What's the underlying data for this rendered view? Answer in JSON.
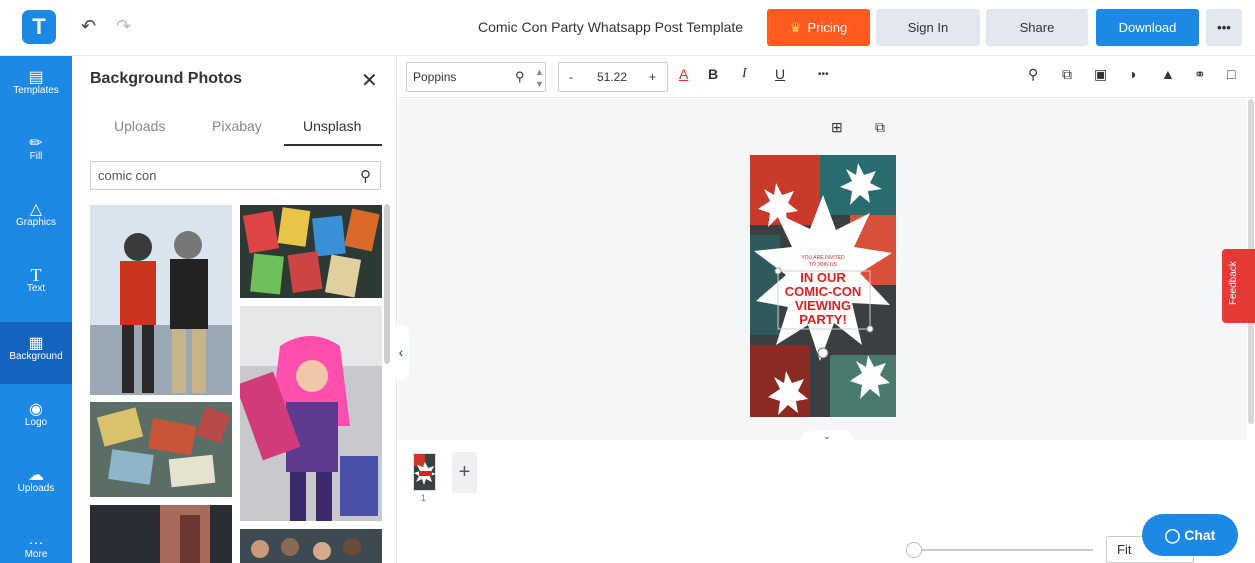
{
  "header": {
    "logo_letter": "T",
    "doc_title": "Comic Con Party Whatsapp Post Template",
    "pricing_label": "Pricing",
    "signin_label": "Sign In",
    "share_label": "Share",
    "download_label": "Download",
    "more_label": "•••"
  },
  "rail": {
    "items": [
      {
        "label": "Templates",
        "icon": "templates-icon"
      },
      {
        "label": "Fill",
        "icon": "pencil-icon"
      },
      {
        "label": "Graphics",
        "icon": "shapes-icon"
      },
      {
        "label": "Text",
        "icon": "text-icon"
      },
      {
        "label": "Background",
        "icon": "background-icon"
      },
      {
        "label": "Logo",
        "icon": "logo-icon"
      },
      {
        "label": "Uploads",
        "icon": "cloud-upload-icon"
      },
      {
        "label": "More",
        "icon": "more-icon"
      }
    ],
    "active": "Background"
  },
  "panel": {
    "title": "Background Photos",
    "tabs": [
      "Uploads",
      "Pixabay",
      "Unsplash"
    ],
    "active_tab": "Unsplash",
    "search_value": "comic con"
  },
  "toolbar": {
    "font": "Poppins",
    "font_size": "51.22",
    "minus": "-",
    "plus": "+",
    "more": "•••"
  },
  "poster": {
    "small_text_1": "YOU ARE INVITED",
    "small_text_2": "TO JOIN US",
    "headline_1": "IN OUR",
    "headline_2": "COMIC-CON",
    "headline_3": "VIEWING",
    "headline_4": "PARTY!"
  },
  "pages": {
    "page_number": "1",
    "add_label": "+"
  },
  "zoom": {
    "fit_label": "Fit"
  },
  "feedback_label": "Feedback",
  "chat_label": "Chat",
  "colors": {
    "brand": "#1e88e5",
    "pricing": "#ff5a1f",
    "feedback": "#e53935",
    "poster_red": "#e02020"
  }
}
